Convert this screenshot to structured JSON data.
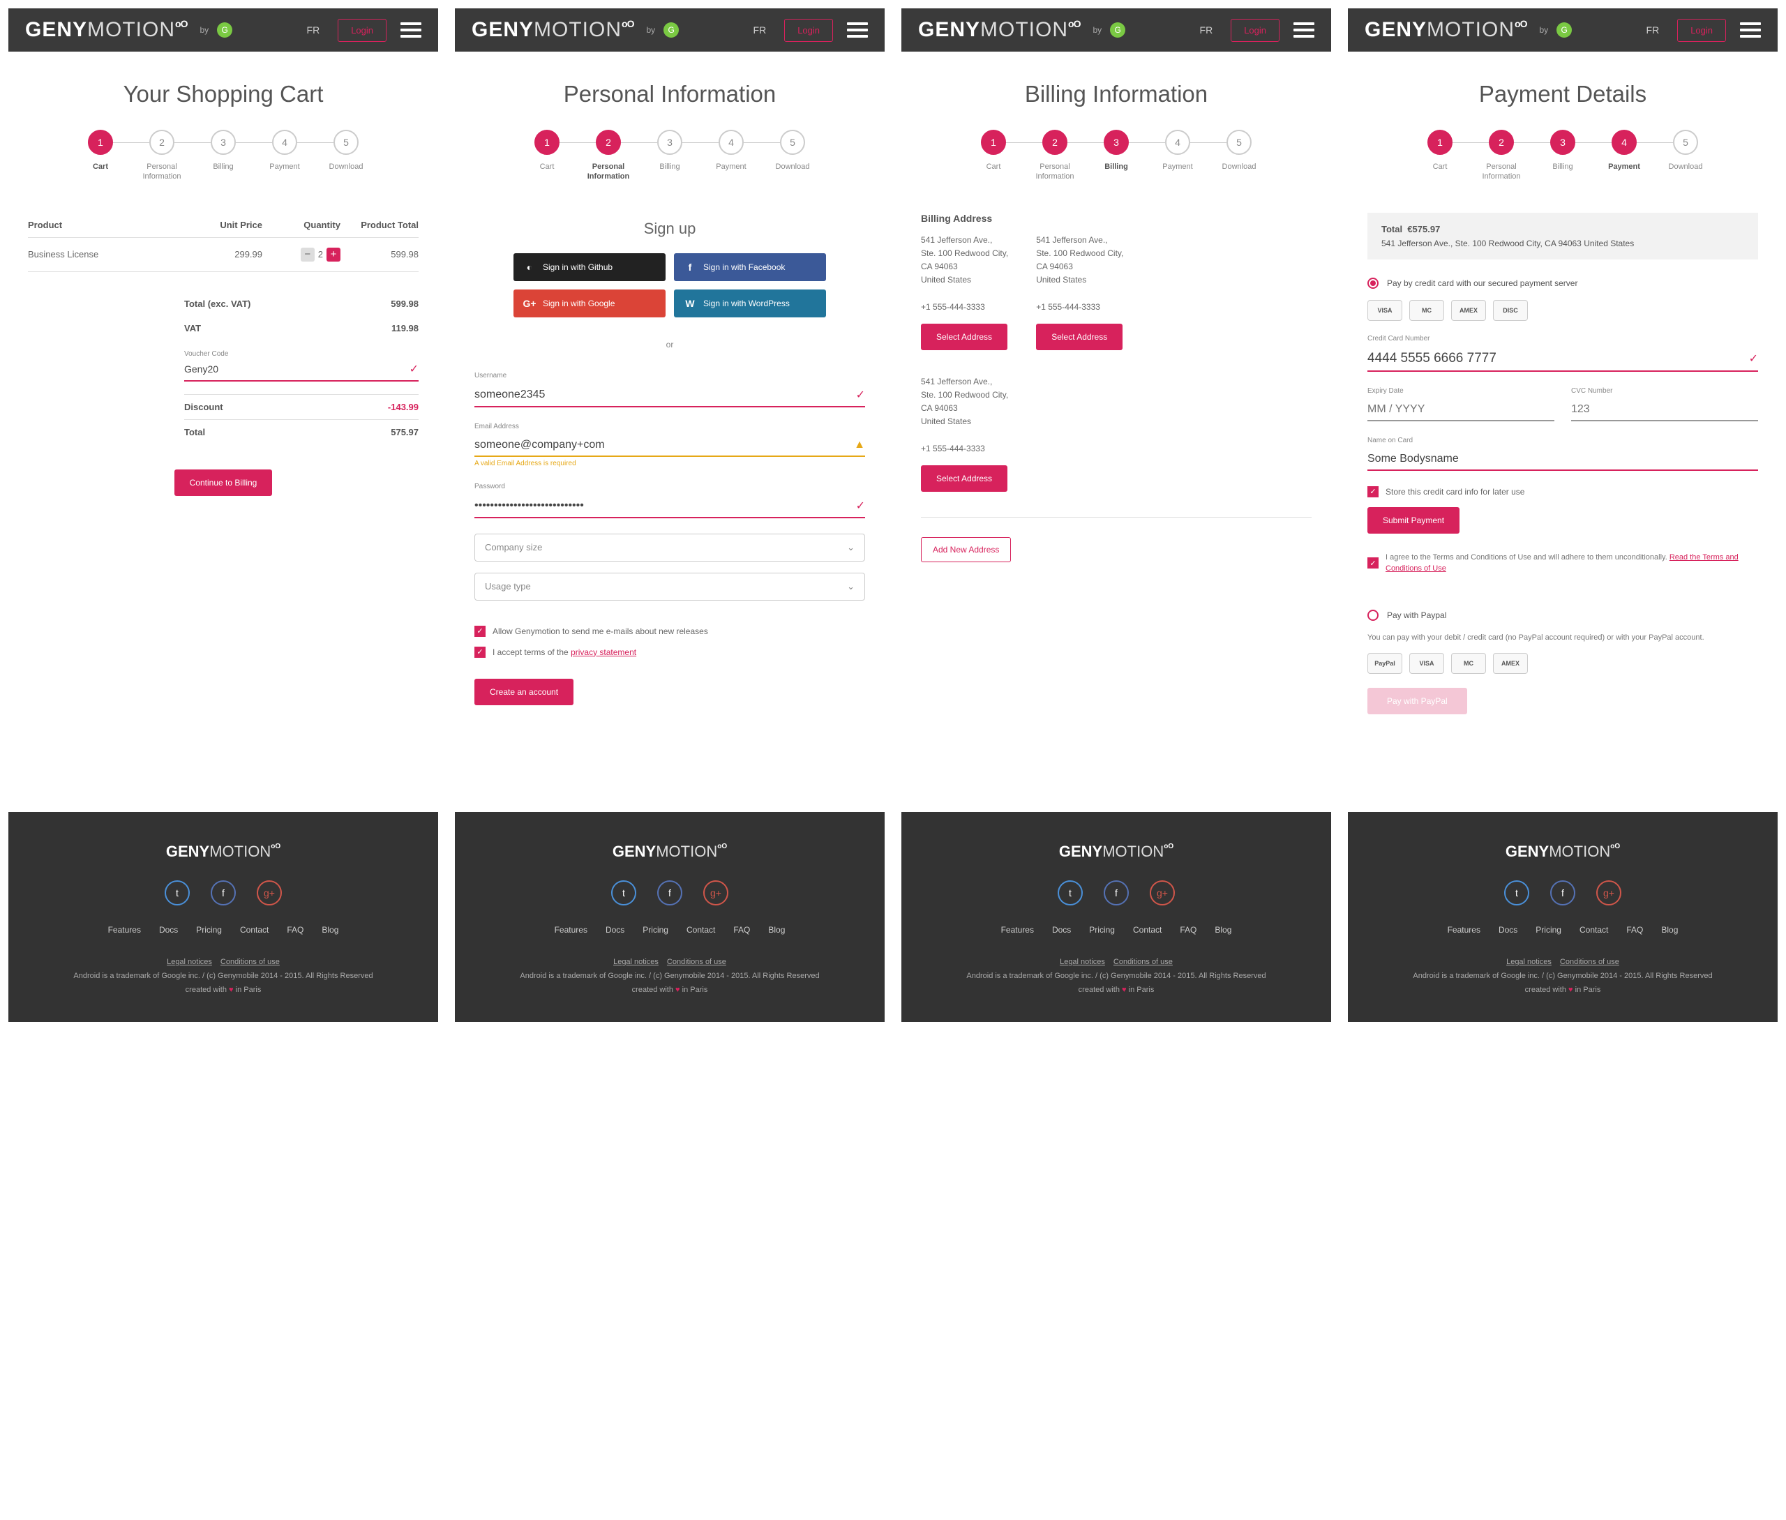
{
  "brand": {
    "geny": "GENY",
    "motion": "MOTION",
    "by": "by"
  },
  "header": {
    "lang": "FR",
    "login": "Login"
  },
  "stepLabels": [
    "Cart",
    "Personal Information",
    "Billing",
    "Payment",
    "Download"
  ],
  "screens": {
    "cart": {
      "title": "Your Shopping Cart",
      "cols": {
        "product": "Product",
        "unit": "Unit Price",
        "qty": "Quantity",
        "total": "Product Total"
      },
      "item": {
        "name": "Business License",
        "unit": "299.99",
        "qty": "2",
        "total": "599.98"
      },
      "totals": {
        "exc_label": "Total (exc. VAT)",
        "exc_val": "599.98",
        "vat_label": "VAT",
        "vat_val": "119.98",
        "voucher_label": "Voucher Code",
        "voucher_val": "Geny20",
        "discount_label": "Discount",
        "discount_val": "-143.99",
        "total_label": "Total",
        "total_val": "575.97"
      },
      "cta": "Continue to Billing"
    },
    "personal": {
      "title": "Personal Information",
      "signup": "Sign up",
      "social": {
        "github": "Sign in with Github",
        "facebook": "Sign in with Facebook",
        "google": "Sign in with Google",
        "wordpress": "Sign in with WordPress"
      },
      "or": "or",
      "fields": {
        "username_label": "Username",
        "username_val": "someone2345",
        "email_label": "Email Address",
        "email_val": "someone@company+com",
        "email_err": "A valid Email Address is required",
        "password_label": "Password",
        "password_val": "••••••••••••••••••••••••••••",
        "company": "Company size",
        "usage": "Usage type"
      },
      "checks": {
        "mails": "Allow Genymotion to send me e-mails about new releases",
        "terms_a": "I accept terms of the ",
        "terms_b": "privacy statement"
      },
      "cta": "Create an account"
    },
    "billing": {
      "title": "Billing Information",
      "heading": "Billing Address",
      "addr": {
        "l1": "541 Jefferson Ave.,",
        "l2": "Ste. 100 Redwood City,",
        "l3": "CA 94063",
        "l4": "United States",
        "phone": "+1 555-444-3333"
      },
      "select": "Select Address",
      "add": "Add New Address"
    },
    "payment": {
      "title": "Payment Details",
      "summary": {
        "total_label": "Total",
        "total_val": "€575.97",
        "addr": "541 Jefferson Ave.,  Ste. 100 Redwood City,  CA 94063 United States"
      },
      "opt_card": "Pay by credit card with our secured payment server",
      "cc": {
        "num_label": "Credit Card Number",
        "num_val": "4444 5555 6666 7777",
        "exp_label": "Expiry Date",
        "exp_ph": "MM / YYYY",
        "cvc_label": "CVC Number",
        "cvc_ph": "123",
        "name_label": "Name on Card",
        "name_val": "Some Bodysname"
      },
      "store": "Store this credit card info for later use",
      "submit": "Submit Payment",
      "agree_a": "I agree to the Terms and Conditions of Use and will adhere to them unconditionally. ",
      "agree_b": "Read the Terms and Conditions of Use",
      "opt_paypal": "Pay with Paypal",
      "paypal_note": "You can pay with your debit / credit card (no PayPal account required) or with your PayPal account.",
      "paypal_btn": "Pay with PayPal",
      "cards": [
        "VISA",
        "MC",
        "AMEX",
        "DISC"
      ],
      "pp_cards": [
        "PayPal",
        "VISA",
        "MC",
        "AMEX"
      ]
    }
  },
  "footer": {
    "nav": [
      "Features",
      "Docs",
      "Pricing",
      "Contact",
      "FAQ",
      "Blog"
    ],
    "legal1": "Legal notices",
    "legal2": "Conditions of use",
    "copy": "Android is a trademark of Google inc.  /  (c) Genymobile 2014 - 2015. All Rights Reserved",
    "made_a": "created with ",
    "made_b": " in Paris"
  }
}
